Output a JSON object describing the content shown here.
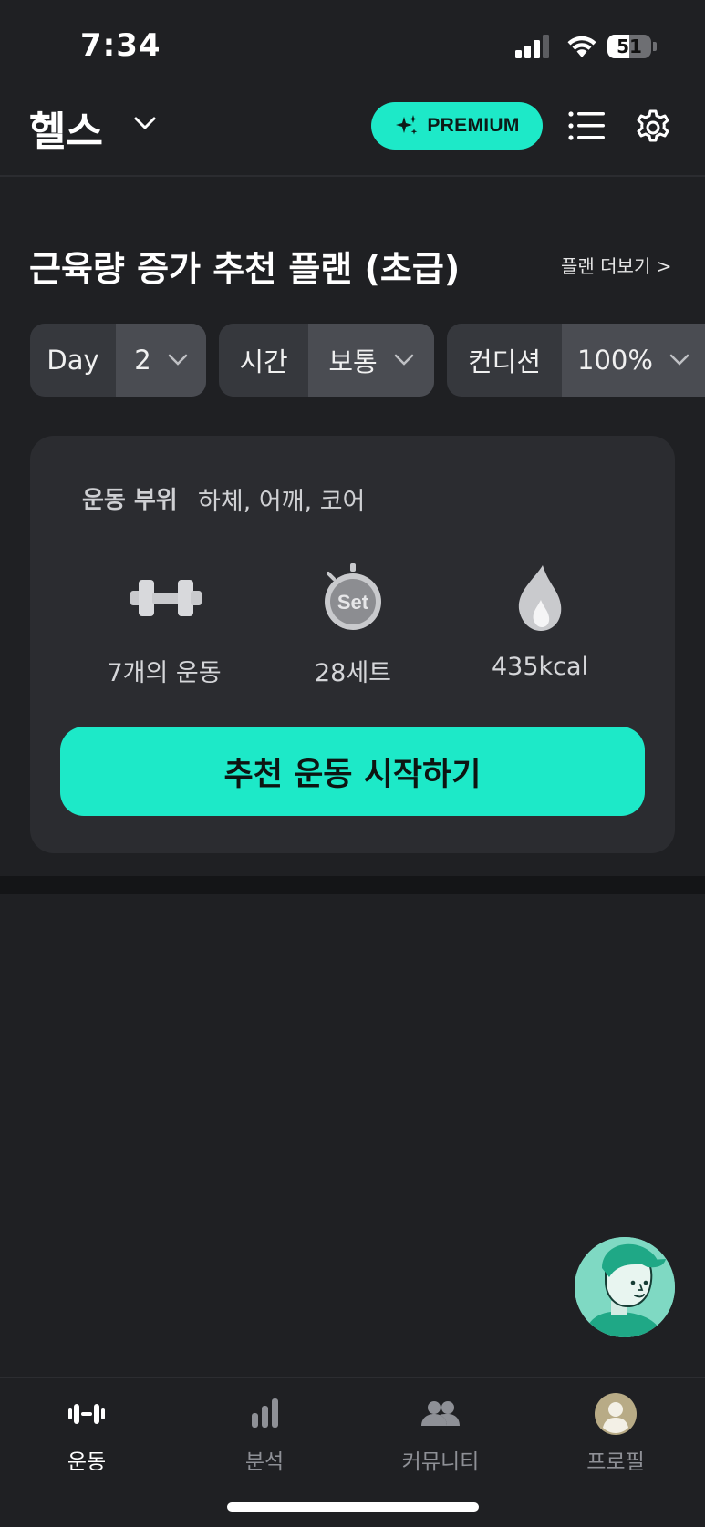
{
  "status_bar": {
    "time": "7:34",
    "battery": "51",
    "battery_level": 0.51
  },
  "header": {
    "title": "헬스",
    "premium_label": "PREMIUM"
  },
  "plan": {
    "title": "근육량 증가 추천 플랜 (초급)",
    "more_link": "플랜 더보기 >"
  },
  "filters": [
    {
      "label": "Day",
      "value": "2"
    },
    {
      "label": "시간",
      "value": "보통"
    },
    {
      "label": "컨디션",
      "value": "100%"
    }
  ],
  "card": {
    "area_label": "운동 부위",
    "area_value": "하체, 어깨, 코어",
    "stats": [
      {
        "icon": "dumbbell-icon",
        "text": "7개의 운동"
      },
      {
        "icon": "stopwatch-set-icon",
        "text": "28세트",
        "icon_text": "Set"
      },
      {
        "icon": "flame-icon",
        "text": "435kcal"
      }
    ],
    "start_button": "추천 운동 시작하기"
  },
  "nav": [
    {
      "icon": "workout-icon",
      "label": "운동",
      "active": true
    },
    {
      "icon": "analysis-icon",
      "label": "분석",
      "active": false
    },
    {
      "icon": "community-icon",
      "label": "커뮤니티",
      "active": false
    },
    {
      "icon": "profile-icon",
      "label": "프로필",
      "active": false
    }
  ],
  "colors": {
    "accent": "#1de9c8",
    "background": "#1f2023",
    "card": "#2b2c30",
    "pill_label": "#36383d",
    "pill_value": "#4a4c52"
  }
}
